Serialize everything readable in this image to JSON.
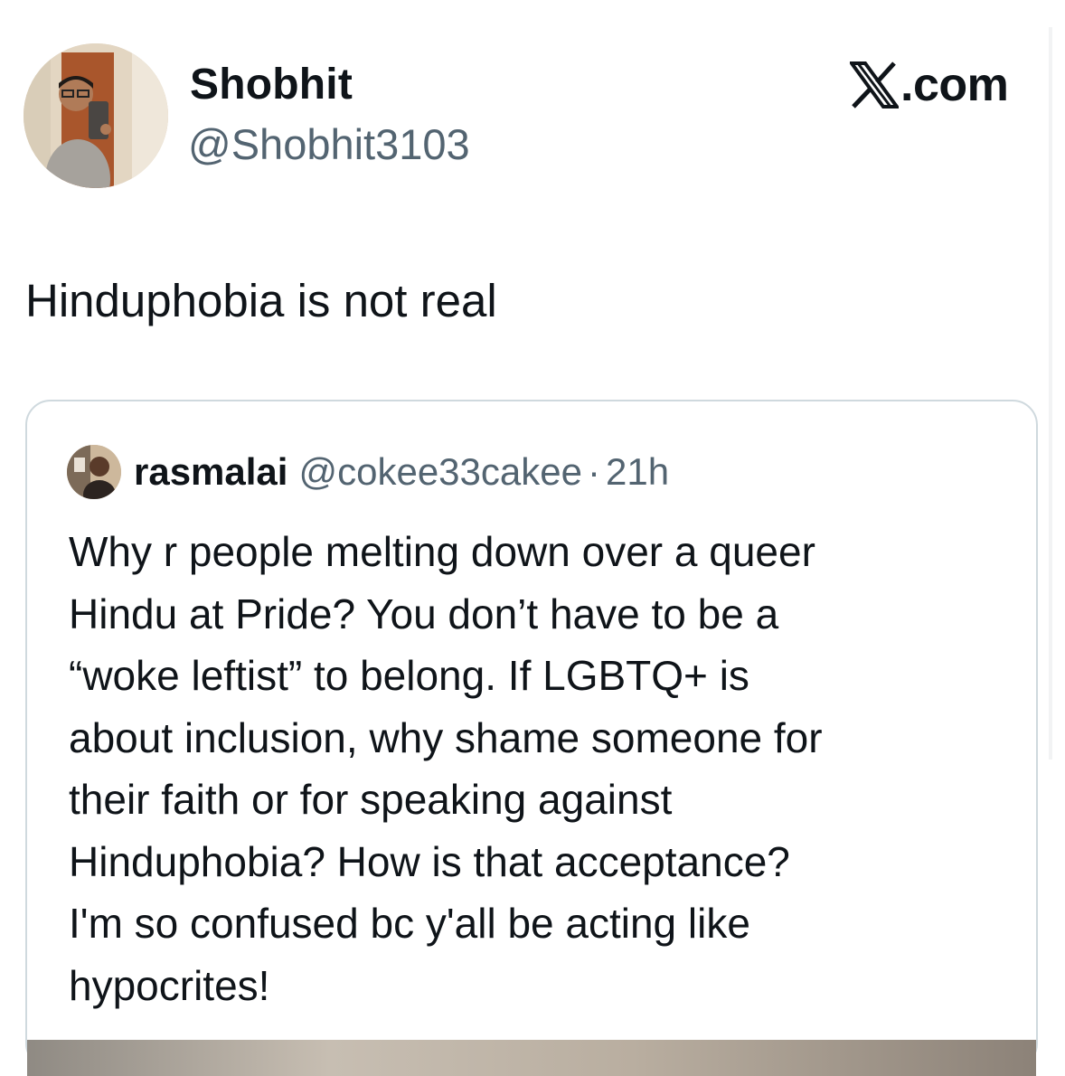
{
  "brand": {
    "icon": "x-logo-icon",
    "label": ".com"
  },
  "author": {
    "display_name": "Shobhit",
    "handle": "@Shobhit3103",
    "avatar_icon": "user-avatar-icon"
  },
  "tweet": {
    "text": "Hinduphobia is not real"
  },
  "quoted_tweet": {
    "display_name": "rasmalai",
    "handle": "@cokee33cakee",
    "separator": "·",
    "time": "21h",
    "avatar_icon": "quoted-user-avatar-icon",
    "lines": [
      "Why r people melting down over a queer",
      "Hindu at Pride? You don’t have to be a",
      "“woke leftist” to belong. If LGBTQ+ is",
      "about inclusion, why shame someone for",
      "their faith or for speaking against",
      "Hinduphobia? How is that acceptance?",
      "I'm so confused bc y'all be acting like",
      "hypocrites!"
    ]
  },
  "colors": {
    "text": "#0f1419",
    "secondary_text": "#536471",
    "border": "#cfd9de",
    "background": "#ffffff"
  }
}
